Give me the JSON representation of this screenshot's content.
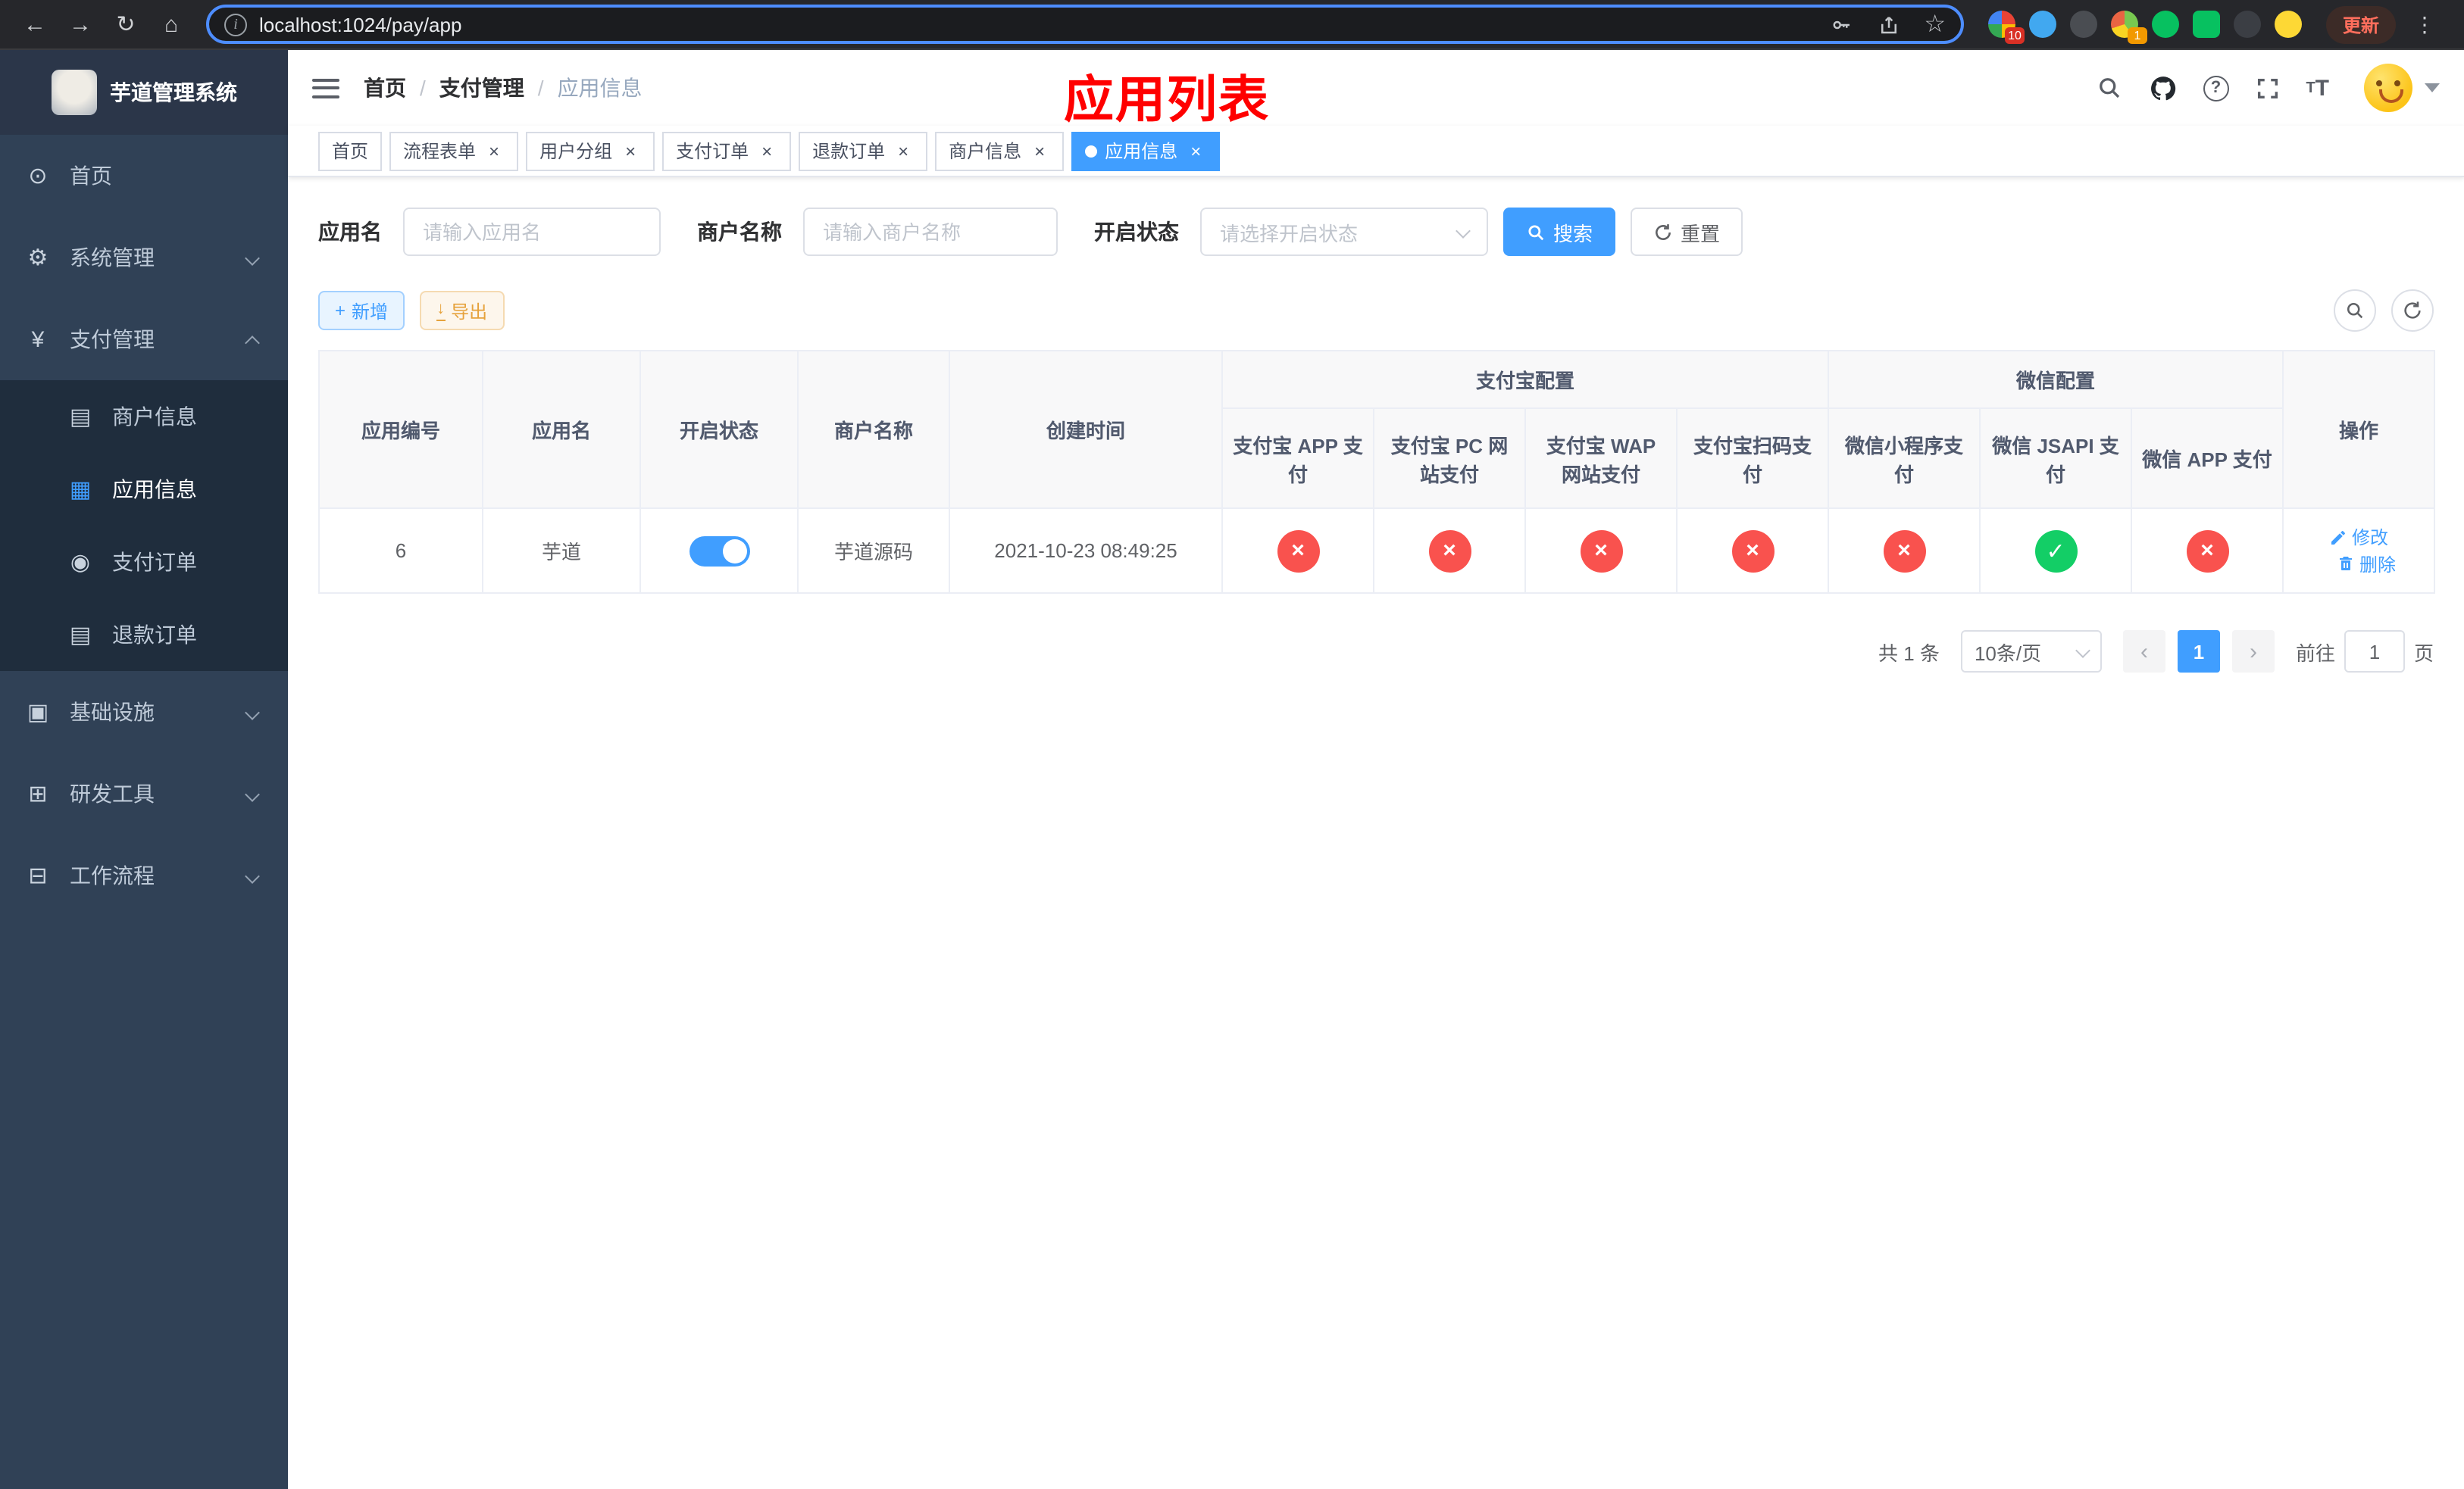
{
  "browser": {
    "url": "localhost:1024/pay/app",
    "update_label": "更新",
    "ext_badge_1": "10",
    "ext_badge_2": "1"
  },
  "sidebar": {
    "title": "芋道管理系统",
    "menu_home": "首页",
    "menu_system": "系统管理",
    "menu_payment": "支付管理",
    "sub_merchant": "商户信息",
    "sub_app": "应用信息",
    "sub_pay_order": "支付订单",
    "sub_refund_order": "退款订单",
    "menu_infra": "基础设施",
    "menu_devtools": "研发工具",
    "menu_workflow": "工作流程"
  },
  "navbar": {
    "breadcrumb1": "首页",
    "breadcrumb2": "支付管理",
    "breadcrumb3": "应用信息",
    "page_title": "应用列表"
  },
  "tabs": {
    "home": "首页",
    "flow_form": "流程表单",
    "user_group": "用户分组",
    "pay_order": "支付订单",
    "refund_order": "退款订单",
    "merchant_info": "商户信息",
    "app_info": "应用信息"
  },
  "filters": {
    "app_name_label": "应用名",
    "app_name_placeholder": "请输入应用名",
    "merchant_label": "商户名称",
    "merchant_placeholder": "请输入商户名称",
    "status_label": "开启状态",
    "status_placeholder": "请选择开启状态",
    "search_label": "搜索",
    "reset_label": "重置"
  },
  "actions": {
    "add_label": "新增",
    "export_label": "导出"
  },
  "table": {
    "alipay_group": "支付宝配置",
    "wechat_group": "微信配置",
    "col_id": "应用编号",
    "col_name": "应用名",
    "col_status": "开启状态",
    "col_merchant": "商户名称",
    "col_created": "创建时间",
    "col_alipay_app": "支付宝 APP 支付",
    "col_alipay_pc": "支付宝 PC 网站支付",
    "col_alipay_wap": "支付宝 WAP 网站支付",
    "col_alipay_qr": "支付宝扫码支付",
    "col_wx_mini": "微信小程序支付",
    "col_wx_jsapi": "微信 JSAPI 支付",
    "col_wx_app": "微信 APP 支付",
    "col_actions": "操作",
    "row": {
      "id": "6",
      "name": "芋道",
      "enabled": true,
      "merchant": "芋道源码",
      "created": "2021-10-23 08:49:25",
      "alipay_app": false,
      "alipay_pc": false,
      "alipay_wap": false,
      "alipay_qr": false,
      "wx_mini": false,
      "wx_jsapi": true,
      "wx_app": false,
      "edit_label": "修改",
      "delete_label": "删除"
    }
  },
  "pagination": {
    "total_text": "共 1 条",
    "page_size": "10条/页",
    "page": "1",
    "goto_label": "前往",
    "goto_value": "1",
    "unit_label": "页"
  },
  "colors": {
    "primary": "#409eff",
    "danger": "#f9524e",
    "success": "#13ce66",
    "title_red": "#ff0000",
    "sidebar_bg": "#304156",
    "submenu_bg": "#1f2d3d"
  }
}
